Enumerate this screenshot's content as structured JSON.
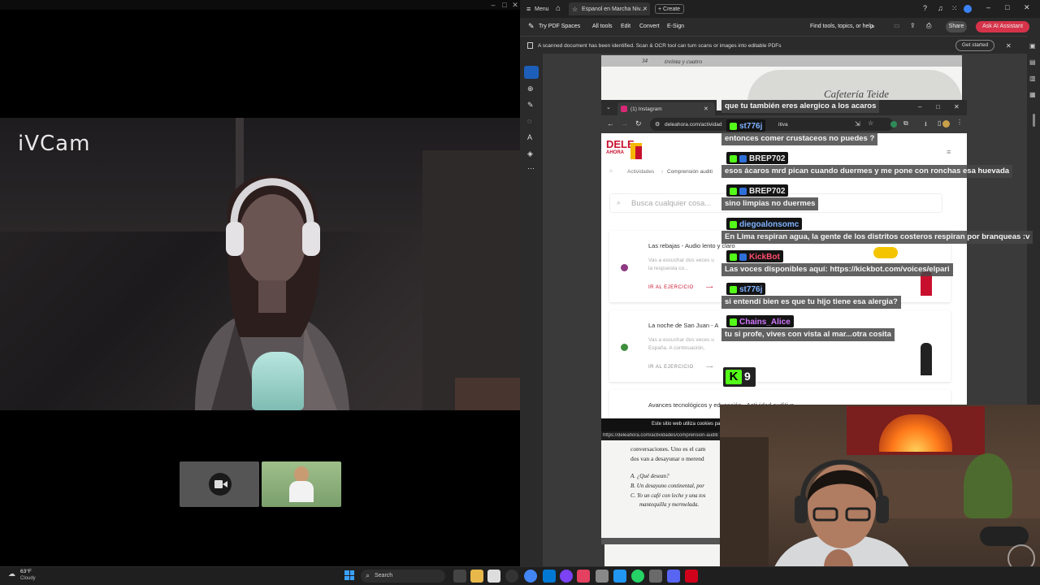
{
  "call": {
    "logo": "iVCam"
  },
  "taskbar": {
    "weather_temp": "63°F",
    "weather_desc": "Cloudy",
    "search_label": "Search"
  },
  "acrobat": {
    "menu_label": "Menu",
    "tab_title": "Espanol en Marcha Niv...",
    "create_label": "Create",
    "try_spaces": "Try PDF Spaces",
    "all_tools": "All tools",
    "edit": "Edit",
    "convert": "Convert",
    "esign": "E-Sign",
    "find_tools": "Find tools, topics, or help",
    "share": "Share",
    "ai_assistant": "Ask AI Assistant",
    "banner_text": "A scanned document has been identified. Scan & OCR tool can turn scans or images into editable PDFs",
    "get_started": "Get started",
    "page_header": "treinta y cuatro",
    "page_number": "34",
    "page_heading": "Cafetería Teide",
    "page_lines": [
      "conversaciones. Uno es el cam",
      "dos van a desayunar o merend"
    ],
    "page_options": [
      "A. ¿Qué desean?",
      "B. Un desayuno continental, por",
      "C. Yo un café con leche y una tos",
      "mantequilla y mermelada."
    ]
  },
  "browser": {
    "tab_title": "(1) Instagram",
    "url_start": "deleahora.com/actividad",
    "url_end": "itiva",
    "status_url": "https://deleahora.com/actividades/comprension-auditi",
    "cookie_text": "Este sitio web utiliza cookies pa",
    "logo_top": "DELE",
    "logo_bottom": "AHORA",
    "crumb1": "Actividades",
    "crumb2": "Comprensión auditi",
    "search_placeholder": "Busca cualquier cosa...",
    "exercise_link": "IR AL EJERCICIO",
    "items": [
      {
        "title": "Las rebajas - Audio lento y claro",
        "desc1": "Vas a escuchar dos veces u",
        "desc2": "la respuesta co...",
        "dot": "#8e3a82"
      },
      {
        "title": "La noche de San Juan - A",
        "desc1": "Vas a escuchar dos veces u",
        "desc2": "España. A continuación,",
        "dot": "#3e8e3e"
      },
      {
        "title": "Avances tecnológicos y educación - Actividad auditiva",
        "desc1": "",
        "desc2": "",
        "dot": ""
      }
    ]
  },
  "chat": {
    "top_message": "que tu también eres alergico a los acaros",
    "messages": [
      {
        "user": "st776j",
        "user_color": "#7fb2ff",
        "text": "entonces comer crustaceos no puedes ?"
      },
      {
        "user": "BREP702",
        "user_color": "#e9e9e9",
        "text": "esos ácaros mrd pican cuando duermes y me pone con ronchas esa huevada"
      },
      {
        "user": "BREP702",
        "user_color": "#e9e9e9",
        "text": "sino limpias no duermes"
      },
      {
        "user": "diegoalonsomc",
        "user_color": "#7fb2ff",
        "text": "En Lima respiran agua, la gente de los distritos costeros respiran por branqueas :v"
      },
      {
        "user": "KickBot",
        "user_color": "#ff4d6d",
        "text": "Las voces disponibles aquí: https://kickbot.com/voices/elpari"
      },
      {
        "user": "st776j",
        "user_color": "#7fb2ff",
        "text": "si entendí bien es que tu hijo tiene esa alergia?"
      },
      {
        "user": "Chains_Alice",
        "user_color": "#d277ff",
        "text": "tu si profe, vives con vista al mar...otra cosita"
      }
    ],
    "viewer_count": "9",
    "accent": "#53fc18"
  }
}
